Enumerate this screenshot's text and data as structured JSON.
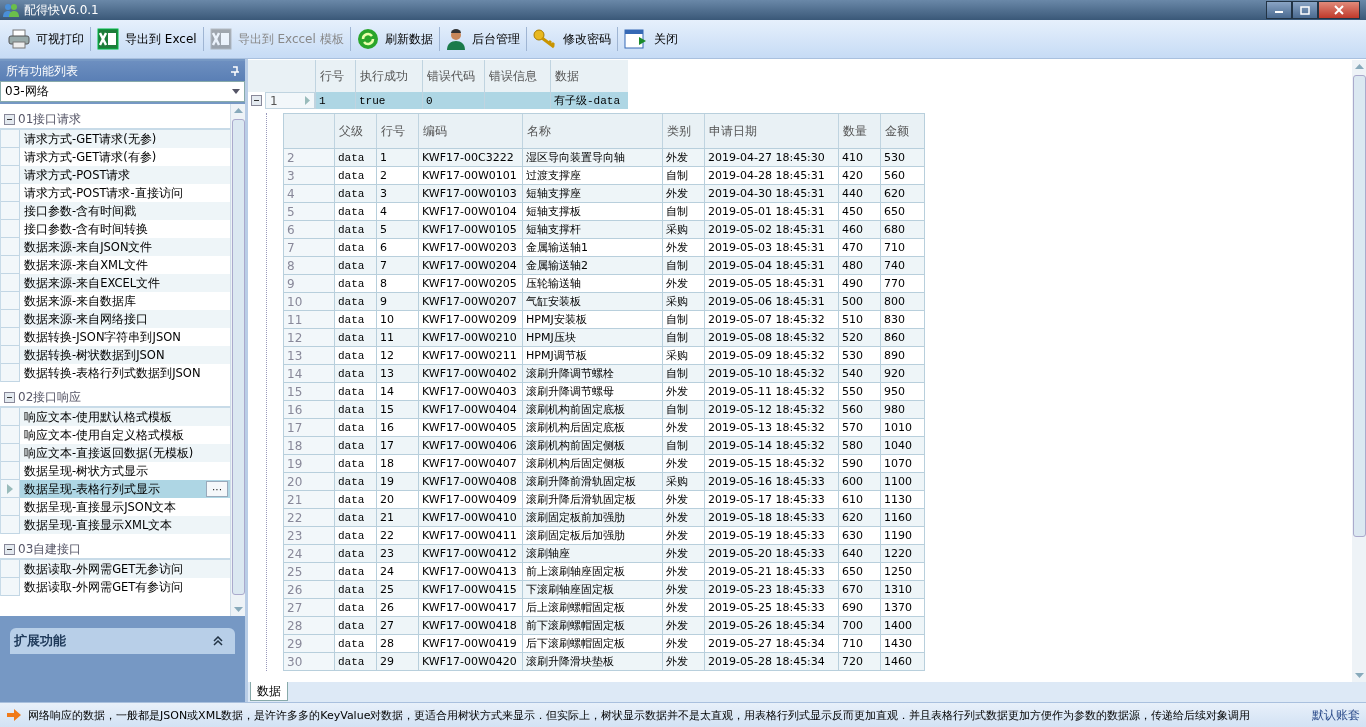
{
  "window": {
    "title": "配得快V6.0.1"
  },
  "toolbar": [
    {
      "label": "可视打印",
      "disabled": false
    },
    {
      "label": "导出到 Excel",
      "disabled": false
    },
    {
      "label": "导出到 Exccel 模板",
      "disabled": true
    },
    {
      "label": "刷新数据",
      "disabled": false
    },
    {
      "label": "后台管理",
      "disabled": false
    },
    {
      "label": "修改密码",
      "disabled": false
    },
    {
      "label": "关闭",
      "disabled": false
    }
  ],
  "sidebar": {
    "title": "所有功能列表",
    "category": "03-网络",
    "groups": [
      {
        "title": "01接口请求",
        "expanded": true,
        "items": [
          {
            "label": "请求方式-GET请求(无参)",
            "selected": false
          },
          {
            "label": "请求方式-GET请求(有参)",
            "selected": false
          },
          {
            "label": "请求方式-POST请求",
            "selected": false
          },
          {
            "label": "请求方式-POST请求-直接访问",
            "selected": false
          },
          {
            "label": "接口参数-含有时间戳",
            "selected": false
          },
          {
            "label": "接口参数-含有时间转换",
            "selected": false
          },
          {
            "label": "数据来源-来自JSON文件",
            "selected": false
          },
          {
            "label": "数据来源-来自XML文件",
            "selected": false
          },
          {
            "label": "数据来源-来自EXCEL文件",
            "selected": false
          },
          {
            "label": "数据来源-来自数据库",
            "selected": false
          },
          {
            "label": "数据来源-来自网络接口",
            "selected": false
          },
          {
            "label": "数据转换-JSON字符串到JSON",
            "selected": false
          },
          {
            "label": "数据转换-树状数据到JSON",
            "selected": false
          },
          {
            "label": "数据转换-表格行列式数据到JSON",
            "selected": false
          }
        ]
      },
      {
        "title": "02接口响应",
        "expanded": true,
        "items": [
          {
            "label": "响应文本-使用默认格式模板",
            "selected": false
          },
          {
            "label": "响应文本-使用自定义格式模板",
            "selected": false
          },
          {
            "label": "响应文本-直接返回数据(无模板)",
            "selected": false
          },
          {
            "label": "数据呈现-树状方式显示",
            "selected": false
          },
          {
            "label": "数据呈现-表格行列式显示",
            "selected": true
          },
          {
            "label": "数据呈现-直接显示JSON文本",
            "selected": false
          },
          {
            "label": "数据呈现-直接显示XML文本",
            "selected": false
          }
        ]
      },
      {
        "title": "03自建接口",
        "expanded": true,
        "items": [
          {
            "label": "数据读取-外网需GET无参访问",
            "selected": false
          },
          {
            "label": "数据读取-外网需GET有参访问",
            "selected": false
          }
        ]
      }
    ],
    "ellipsis": "···",
    "extension_panel": {
      "title": "扩展功能",
      "expanded": true
    }
  },
  "master_grid": {
    "columns": [
      "行号",
      "执行成功",
      "错误代码",
      "错误信息",
      "数据"
    ],
    "rows": [
      {
        "row_header": "1",
        "expanded": true,
        "selected": true,
        "cells": [
          "1",
          "true",
          "0",
          "",
          "有子级-data"
        ]
      }
    ]
  },
  "detail_grid": {
    "columns": [
      "父级",
      "行号",
      "编码",
      "名称",
      "类别",
      "申请日期",
      "数量",
      "金额"
    ],
    "rows": [
      {
        "row_header": "2",
        "cells": [
          "data",
          "1",
          "KWF17-00C3222",
          "湿区导向装置导向轴",
          "外发",
          "2019-04-27 18:45:30",
          "410",
          "530"
        ]
      },
      {
        "row_header": "3",
        "cells": [
          "data",
          "2",
          "KWF17-00W0101",
          "过渡支撑座",
          "自制",
          "2019-04-28 18:45:31",
          "420",
          "560"
        ]
      },
      {
        "row_header": "4",
        "cells": [
          "data",
          "3",
          "KWF17-00W0103",
          "短轴支撑座",
          "外发",
          "2019-04-30 18:45:31",
          "440",
          "620"
        ]
      },
      {
        "row_header": "5",
        "cells": [
          "data",
          "4",
          "KWF17-00W0104",
          "短轴支撑板",
          "自制",
          "2019-05-01 18:45:31",
          "450",
          "650"
        ]
      },
      {
        "row_header": "6",
        "cells": [
          "data",
          "5",
          "KWF17-00W0105",
          "短轴支撑杆",
          "采购",
          "2019-05-02 18:45:31",
          "460",
          "680"
        ]
      },
      {
        "row_header": "7",
        "cells": [
          "data",
          "6",
          "KWF17-00W0203",
          "金属输送轴1",
          "外发",
          "2019-05-03 18:45:31",
          "470",
          "710"
        ]
      },
      {
        "row_header": "8",
        "cells": [
          "data",
          "7",
          "KWF17-00W0204",
          "金属输送轴2",
          "自制",
          "2019-05-04 18:45:31",
          "480",
          "740"
        ]
      },
      {
        "row_header": "9",
        "cells": [
          "data",
          "8",
          "KWF17-00W0205",
          "压轮输送轴",
          "外发",
          "2019-05-05 18:45:31",
          "490",
          "770"
        ]
      },
      {
        "row_header": "10",
        "cells": [
          "data",
          "9",
          "KWF17-00W0207",
          "气缸安装板",
          "采购",
          "2019-05-06 18:45:31",
          "500",
          "800"
        ]
      },
      {
        "row_header": "11",
        "cells": [
          "data",
          "10",
          "KWF17-00W0209",
          "HPMJ安装板",
          "自制",
          "2019-05-07 18:45:32",
          "510",
          "830"
        ]
      },
      {
        "row_header": "12",
        "cells": [
          "data",
          "11",
          "KWF17-00W0210",
          "HPMJ压块",
          "自制",
          "2019-05-08 18:45:32",
          "520",
          "860"
        ]
      },
      {
        "row_header": "13",
        "cells": [
          "data",
          "12",
          "KWF17-00W0211",
          "HPMJ调节板",
          "采购",
          "2019-05-09 18:45:32",
          "530",
          "890"
        ]
      },
      {
        "row_header": "14",
        "cells": [
          "data",
          "13",
          "KWF17-00W0402",
          "滚刷升降调节螺栓",
          "自制",
          "2019-05-10 18:45:32",
          "540",
          "920"
        ]
      },
      {
        "row_header": "15",
        "cells": [
          "data",
          "14",
          "KWF17-00W0403",
          "滚刷升降调节螺母",
          "外发",
          "2019-05-11 18:45:32",
          "550",
          "950"
        ]
      },
      {
        "row_header": "16",
        "cells": [
          "data",
          "15",
          "KWF17-00W0404",
          "滚刷机构前固定底板",
          "自制",
          "2019-05-12 18:45:32",
          "560",
          "980"
        ]
      },
      {
        "row_header": "17",
        "cells": [
          "data",
          "16",
          "KWF17-00W0405",
          "滚刷机构后固定底板",
          "外发",
          "2019-05-13 18:45:32",
          "570",
          "1010"
        ]
      },
      {
        "row_header": "18",
        "cells": [
          "data",
          "17",
          "KWF17-00W0406",
          "滚刷机构前固定侧板",
          "自制",
          "2019-05-14 18:45:32",
          "580",
          "1040"
        ]
      },
      {
        "row_header": "19",
        "cells": [
          "data",
          "18",
          "KWF17-00W0407",
          "滚刷机构后固定侧板",
          "外发",
          "2019-05-15 18:45:32",
          "590",
          "1070"
        ]
      },
      {
        "row_header": "20",
        "cells": [
          "data",
          "19",
          "KWF17-00W0408",
          "滚刷升降前滑轨固定板",
          "采购",
          "2019-05-16 18:45:33",
          "600",
          "1100"
        ]
      },
      {
        "row_header": "21",
        "cells": [
          "data",
          "20",
          "KWF17-00W0409",
          "滚刷升降后滑轨固定板",
          "外发",
          "2019-05-17 18:45:33",
          "610",
          "1130"
        ]
      },
      {
        "row_header": "22",
        "cells": [
          "data",
          "21",
          "KWF17-00W0410",
          "滚刷固定板前加强肋",
          "外发",
          "2019-05-18 18:45:33",
          "620",
          "1160"
        ]
      },
      {
        "row_header": "23",
        "cells": [
          "data",
          "22",
          "KWF17-00W0411",
          "滚刷固定板后加强肋",
          "外发",
          "2019-05-19 18:45:33",
          "630",
          "1190"
        ]
      },
      {
        "row_header": "24",
        "cells": [
          "data",
          "23",
          "KWF17-00W0412",
          "滚刷轴座",
          "外发",
          "2019-05-20 18:45:33",
          "640",
          "1220"
        ]
      },
      {
        "row_header": "25",
        "cells": [
          "data",
          "24",
          "KWF17-00W0413",
          "前上滚刷轴座固定板",
          "外发",
          "2019-05-21 18:45:33",
          "650",
          "1250"
        ]
      },
      {
        "row_header": "26",
        "cells": [
          "data",
          "25",
          "KWF17-00W0415",
          "下滚刷轴座固定板",
          "外发",
          "2019-05-23 18:45:33",
          "670",
          "1310"
        ]
      },
      {
        "row_header": "27",
        "cells": [
          "data",
          "26",
          "KWF17-00W0417",
          "后上滚刷螺帽固定板",
          "外发",
          "2019-05-25 18:45:33",
          "690",
          "1370"
        ]
      },
      {
        "row_header": "28",
        "cells": [
          "data",
          "27",
          "KWF17-00W0418",
          "前下滚刷螺帽固定板",
          "外发",
          "2019-05-26 18:45:34",
          "700",
          "1400"
        ]
      },
      {
        "row_header": "29",
        "cells": [
          "data",
          "28",
          "KWF17-00W0419",
          "后下滚刷螺帽固定板",
          "外发",
          "2019-05-27 18:45:34",
          "710",
          "1430"
        ]
      },
      {
        "row_header": "30",
        "cells": [
          "data",
          "29",
          "KWF17-00W0420",
          "滚刷升降滑块垫板",
          "外发",
          "2019-05-28 18:45:34",
          "720",
          "1460"
        ]
      }
    ]
  },
  "bottom_tabs": [
    {
      "label": "数据",
      "selected": true
    }
  ],
  "status_bar": {
    "message": "网络响应的数据，一般都是JSON或XML数据，是许许多多的KeyValue对数据，更适合用树状方式来显示．但实际上，树状显示数据并不是太直观，用表格行列式显示反而更加直观．并且表格行列式数据更加方便作为参数的数据源，传递给后续对象调用",
    "account": "默认账套"
  }
}
